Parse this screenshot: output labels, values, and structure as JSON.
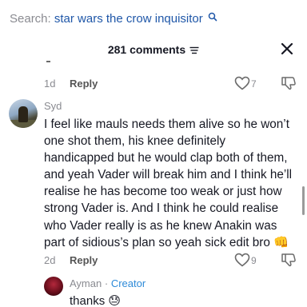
{
  "search": {
    "prefix": "Search:",
    "query": "star wars the crow inquisitor"
  },
  "comments_header": {
    "count_label": "281 comments"
  },
  "icons": {
    "search": "magnifier-icon",
    "filter": "filter-icon",
    "close": "close-icon",
    "like": "heart-outline-icon",
    "dislike": "thumbs-down-outline-icon"
  },
  "comments": [
    {
      "time": "1d",
      "reply_label": "Reply",
      "likes": "7"
    },
    {
      "author": "Syd",
      "lines": [
        "I feel like mauls needs them alive so he won’t",
        "one shot them, his knee definitely",
        "handicapped but he would clap both of them,",
        "and yeah Vader will break him and I think he’ll",
        "realise he has become too weak or just how",
        "strong Vader is. And I think he could realise",
        "who Vader really is as he knew Anakin was",
        "part of sidious’s plan so yeah sick edit bro 👊"
      ],
      "time": "2d",
      "reply_label": "Reply",
      "likes": "9"
    }
  ],
  "reply": {
    "author": "Ayman",
    "separator": "·",
    "badge": "Creator",
    "text": "thanks 😓"
  },
  "colors": {
    "search_query": "#1f57a8",
    "creator_badge": "#2d8ad8",
    "muted_text": "#8a8b91"
  }
}
